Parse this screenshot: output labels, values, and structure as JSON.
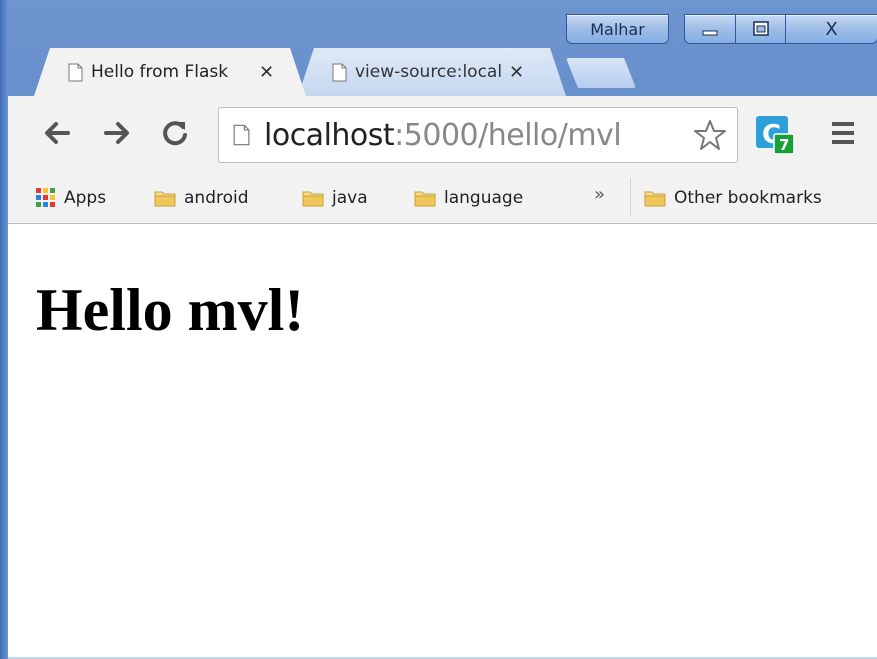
{
  "window": {
    "user_label": "Malhar",
    "minimize_glyph": "—",
    "maximize_glyph": "◻",
    "close_glyph": "X"
  },
  "tabs": [
    {
      "title": "Hello from Flask",
      "close": "✕",
      "icon": "page-icon",
      "active": true
    },
    {
      "title": "view-source:localhost",
      "close": "✕",
      "icon": "page-icon",
      "active": false
    }
  ],
  "toolbar": {
    "back_icon": "back-arrow-icon",
    "forward_icon": "forward-arrow-icon",
    "reload_icon": "reload-icon",
    "url_host": "localhost",
    "url_path": ":5000/hello/mvl",
    "bookmark_icon": "star-icon",
    "extension_badge": "7",
    "extension_letter": "C",
    "menu_icon": "hamburger-menu-icon"
  },
  "bookmarks": {
    "apps_label": "Apps",
    "items": [
      "android",
      "java",
      "language"
    ],
    "overflow": "»",
    "other_label": "Other bookmarks"
  },
  "page": {
    "heading": "Hello mvl!"
  },
  "colors": {
    "frame": "#5b86c8",
    "toolbar": "#f2f2f2",
    "folder": "#f0c75a",
    "extension": "#2d9fd9",
    "badge": "#1a9e3a"
  }
}
